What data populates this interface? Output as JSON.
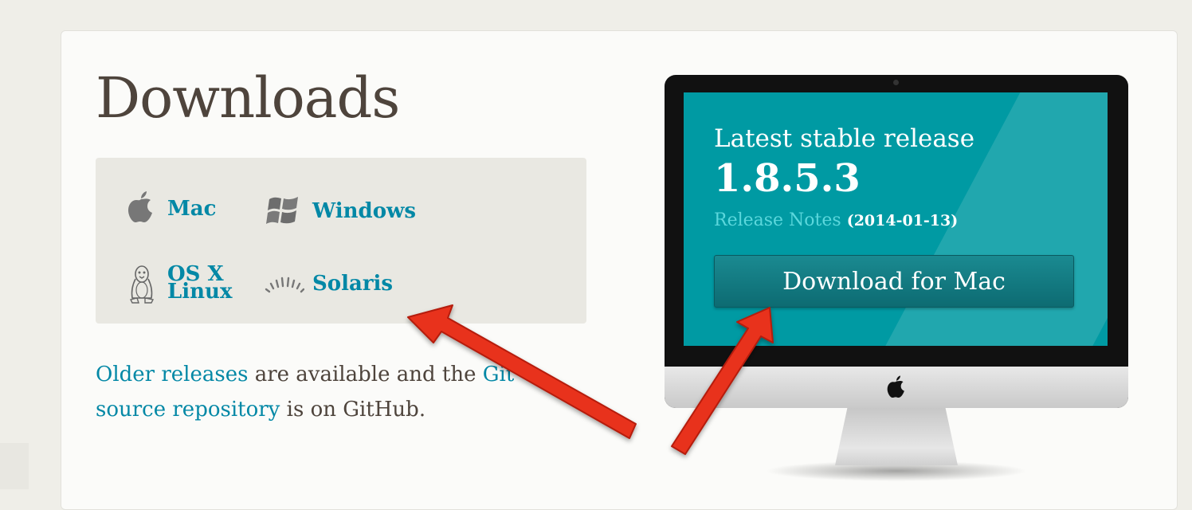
{
  "page": {
    "title": "Downloads"
  },
  "platforms": [
    {
      "label": "Mac",
      "icon": "apple-icon"
    },
    {
      "label": "Windows",
      "icon": "windows-icon"
    },
    {
      "label": "Linux",
      "overlay_label": "OS X",
      "icon": "tux-penguin-icon"
    },
    {
      "label": "Solaris",
      "icon": "solaris-sun-icon"
    }
  ],
  "older": {
    "link1": "Older releases",
    "text1": " are available and the ",
    "link2": "Git source repository",
    "text2": " is on GitHub."
  },
  "release": {
    "heading": "Latest stable release",
    "version": "1.8.5.3",
    "notes_label": "Release Notes",
    "date": "(2014-01-13)",
    "button_label": "Download for Mac"
  },
  "colors": {
    "link": "#0388a6",
    "screen": "#009aa3",
    "annotation_arrow": "#e8321c"
  }
}
